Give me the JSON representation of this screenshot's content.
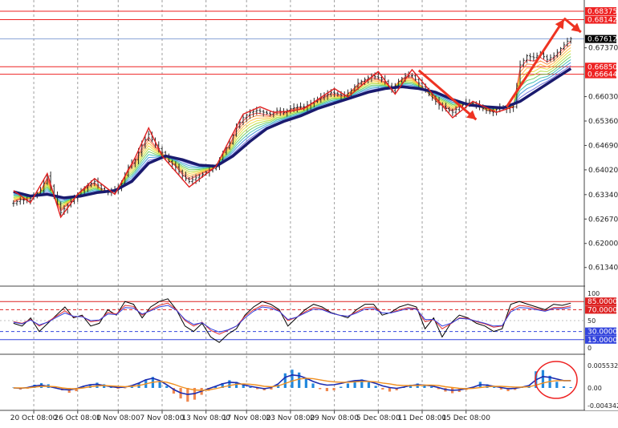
{
  "chart_data": [
    {
      "type": "line",
      "panel": "price",
      "ylim": [
        0.6085,
        0.6855
      ],
      "y_ticks": [
        "0.61340",
        "0.62000",
        "0.62670",
        "0.63340",
        "0.64020",
        "0.64690",
        "0.65360",
        "0.66030",
        "0.67370"
      ],
      "y_tick_values": [
        0.6134,
        0.62,
        0.6267,
        0.6334,
        0.6402,
        0.6469,
        0.6536,
        0.6603,
        0.6737
      ],
      "last_price": {
        "label": "0.67612",
        "value": 0.67612
      },
      "horizontal_levels": [
        {
          "label": "0.68375",
          "value": 0.68375
        },
        {
          "label": "0.68142",
          "value": 0.68142
        },
        {
          "label": "0.66850",
          "value": 0.6685
        },
        {
          "label": "0.66644",
          "value": 0.66644
        }
      ],
      "zigzag": [
        [
          0,
          0.6345
        ],
        [
          5,
          0.6312
        ],
        [
          10,
          0.6392
        ],
        [
          14,
          0.6272
        ],
        [
          19,
          0.6335
        ],
        [
          24,
          0.6378
        ],
        [
          30,
          0.6335
        ],
        [
          36,
          0.6435
        ],
        [
          40,
          0.6517
        ],
        [
          44,
          0.644
        ],
        [
          52,
          0.6355
        ],
        [
          60,
          0.6412
        ],
        [
          64,
          0.6485
        ],
        [
          68,
          0.6555
        ],
        [
          73,
          0.6575
        ],
        [
          77,
          0.656
        ],
        [
          82,
          0.6563
        ],
        [
          86,
          0.657
        ],
        [
          95,
          0.6625
        ],
        [
          99,
          0.6602
        ],
        [
          108,
          0.6672
        ],
        [
          113,
          0.661
        ],
        [
          118,
          0.6677
        ],
        [
          130,
          0.6545
        ],
        [
          136,
          0.659
        ],
        [
          143,
          0.656
        ],
        [
          148,
          0.6575
        ]
      ],
      "close_series": [
        [
          0,
          0.631
        ],
        [
          2,
          0.632
        ],
        [
          4,
          0.6318
        ],
        [
          6,
          0.633
        ],
        [
          8,
          0.6345
        ],
        [
          10,
          0.6385
        ],
        [
          12,
          0.633
        ],
        [
          14,
          0.6285
        ],
        [
          16,
          0.6305
        ],
        [
          18,
          0.6325
        ],
        [
          20,
          0.6345
        ],
        [
          22,
          0.636
        ],
        [
          24,
          0.637
        ],
        [
          26,
          0.635
        ],
        [
          28,
          0.634
        ],
        [
          30,
          0.6345
        ],
        [
          32,
          0.6365
        ],
        [
          34,
          0.641
        ],
        [
          36,
          0.643
        ],
        [
          38,
          0.647
        ],
        [
          40,
          0.65
        ],
        [
          42,
          0.647
        ],
        [
          44,
          0.645
        ],
        [
          46,
          0.6425
        ],
        [
          48,
          0.641
        ],
        [
          50,
          0.6385
        ],
        [
          52,
          0.637
        ],
        [
          54,
          0.638
        ],
        [
          56,
          0.639
        ],
        [
          58,
          0.64
        ],
        [
          60,
          0.641
        ],
        [
          62,
          0.645
        ],
        [
          64,
          0.6475
        ],
        [
          66,
          0.652
        ],
        [
          68,
          0.6545
        ],
        [
          70,
          0.656
        ],
        [
          72,
          0.6565
        ],
        [
          74,
          0.656
        ],
        [
          76,
          0.6555
        ],
        [
          78,
          0.6565
        ],
        [
          80,
          0.656
        ],
        [
          82,
          0.657
        ],
        [
          84,
          0.6575
        ],
        [
          86,
          0.6575
        ],
        [
          88,
          0.6585
        ],
        [
          90,
          0.6595
        ],
        [
          92,
          0.6605
        ],
        [
          94,
          0.6615
        ],
        [
          96,
          0.661
        ],
        [
          98,
          0.6605
        ],
        [
          100,
          0.662
        ],
        [
          102,
          0.664
        ],
        [
          104,
          0.665
        ],
        [
          106,
          0.666
        ],
        [
          108,
          0.6655
        ],
        [
          110,
          0.6645
        ],
        [
          112,
          0.662
        ],
        [
          114,
          0.6645
        ],
        [
          116,
          0.666
        ],
        [
          118,
          0.666
        ],
        [
          120,
          0.664
        ],
        [
          122,
          0.662
        ],
        [
          124,
          0.66
        ],
        [
          126,
          0.658
        ],
        [
          128,
          0.657
        ],
        [
          130,
          0.656
        ],
        [
          132,
          0.6575
        ],
        [
          134,
          0.6585
        ],
        [
          136,
          0.6585
        ],
        [
          138,
          0.6575
        ],
        [
          140,
          0.6565
        ],
        [
          142,
          0.656
        ],
        [
          144,
          0.6575
        ],
        [
          146,
          0.657
        ],
        [
          148,
          0.6575
        ],
        [
          150,
          0.669
        ],
        [
          152,
          0.6715
        ],
        [
          154,
          0.671
        ],
        [
          156,
          0.672
        ],
        [
          158,
          0.6705
        ],
        [
          160,
          0.6715
        ],
        [
          162,
          0.6735
        ],
        [
          164,
          0.6755
        ],
        [
          165,
          0.6762
        ]
      ],
      "ma_series": [
        [
          0,
          0.6342
        ],
        [
          5,
          0.633
        ],
        [
          10,
          0.6335
        ],
        [
          15,
          0.6325
        ],
        [
          20,
          0.633
        ],
        [
          25,
          0.634
        ],
        [
          30,
          0.6345
        ],
        [
          35,
          0.637
        ],
        [
          40,
          0.642
        ],
        [
          45,
          0.644
        ],
        [
          50,
          0.643
        ],
        [
          55,
          0.6415
        ],
        [
          60,
          0.6412
        ],
        [
          65,
          0.644
        ],
        [
          70,
          0.648
        ],
        [
          75,
          0.6515
        ],
        [
          80,
          0.6535
        ],
        [
          85,
          0.655
        ],
        [
          90,
          0.657
        ],
        [
          95,
          0.6585
        ],
        [
          100,
          0.66
        ],
        [
          105,
          0.6615
        ],
        [
          110,
          0.6625
        ],
        [
          115,
          0.663
        ],
        [
          120,
          0.6625
        ],
        [
          125,
          0.6615
        ],
        [
          130,
          0.6595
        ],
        [
          135,
          0.658
        ],
        [
          140,
          0.6575
        ],
        [
          145,
          0.6572
        ],
        [
          150,
          0.659
        ],
        [
          155,
          0.662
        ],
        [
          160,
          0.665
        ],
        [
          165,
          0.668
        ]
      ],
      "arrows": [
        {
          "from": [
            120,
            0.6675
          ],
          "to": [
            137,
            0.654
          ]
        },
        {
          "from": [
            146,
            0.6575
          ],
          "to": [
            163,
            0.6815
          ]
        },
        {
          "from": [
            163,
            0.6818
          ],
          "to": [
            168,
            0.678
          ]
        }
      ],
      "x_tick_labels": [
        "20 Oct 08:00",
        "26 Oct 08:00",
        "1 Nov 08:00",
        "7 Nov 08:00",
        "13 Nov 08:00",
        "17 Nov 08:00",
        "23 Nov 08:00",
        "29 Nov 08:00",
        "5 Dec 08:00",
        "11 Dec 08:00",
        "15 Dec 08:00"
      ],
      "x_tick_positions": [
        6,
        19,
        31,
        44,
        57,
        69,
        82,
        95,
        108,
        121,
        134
      ],
      "x_range": [
        -4,
        169
      ]
    },
    {
      "type": "line",
      "panel": "oscillator",
      "ylim": [
        0,
        100
      ],
      "y_ticks": [
        "100",
        "50",
        "0"
      ],
      "levels": [
        {
          "label": "85.0000",
          "value": 85,
          "color": "#dd2222"
        },
        {
          "label": "70.0000",
          "value": 70,
          "color": "#dd2222"
        },
        {
          "label": "30.0000",
          "value": 30,
          "color": "#3344dd"
        },
        {
          "label": "15.0000",
          "value": 15,
          "color": "#3344dd"
        }
      ],
      "series": [
        {
          "values": [
            45,
            40,
            55,
            30,
            45,
            60,
            75,
            55,
            60,
            40,
            45,
            70,
            60,
            85,
            80,
            55,
            75,
            85,
            90,
            70,
            40,
            30,
            45,
            20,
            10,
            25,
            35,
            60,
            75,
            85,
            80,
            70,
            40,
            55,
            70,
            80,
            75,
            65,
            60,
            55,
            70,
            80,
            80,
            60,
            65,
            75,
            80,
            75,
            35,
            55,
            20,
            45,
            60,
            55,
            45,
            40,
            30,
            35,
            80,
            85,
            80,
            75,
            70,
            80,
            78,
            82
          ],
          "color": "#000000"
        },
        {
          "values": [
            48,
            45,
            52,
            40,
            48,
            58,
            68,
            57,
            58,
            48,
            50,
            65,
            62,
            78,
            76,
            60,
            70,
            78,
            82,
            70,
            50,
            40,
            47,
            32,
            25,
            32,
            40,
            58,
            70,
            78,
            76,
            68,
            50,
            56,
            66,
            74,
            72,
            64,
            60,
            58,
            66,
            74,
            75,
            64,
            64,
            70,
            74,
            72,
            48,
            52,
            35,
            44,
            55,
            54,
            48,
            44,
            38,
            40,
            70,
            78,
            76,
            72,
            68,
            74,
            74,
            77
          ],
          "color": "#e03030"
        },
        {
          "values": [
            47,
            44,
            51,
            42,
            47,
            56,
            64,
            58,
            57,
            50,
            51,
            62,
            61,
            74,
            73,
            62,
            68,
            75,
            78,
            69,
            52,
            43,
            46,
            35,
            29,
            33,
            40,
            55,
            67,
            75,
            73,
            67,
            52,
            56,
            64,
            71,
            70,
            64,
            60,
            58,
            64,
            71,
            72,
            64,
            64,
            68,
            72,
            71,
            52,
            52,
            40,
            45,
            54,
            53,
            49,
            45,
            40,
            41,
            66,
            74,
            73,
            70,
            67,
            72,
            72,
            74
          ],
          "color": "#3040e0"
        }
      ]
    },
    {
      "type": "bar",
      "panel": "macd",
      "y_ticks": [
        "0.0055325",
        "0.00",
        "-0.0043426"
      ],
      "y_tick_values": [
        0.0055325,
        0.0,
        -0.0043426
      ],
      "ylim": [
        -0.0043426,
        0.0055325
      ],
      "histogram": [
        0.0001,
        -0.0004,
        -0.0002,
        0.0008,
        0.0012,
        0.0009,
        0.0003,
        -0.0006,
        -0.0012,
        -0.0008,
        0.0004,
        0.0009,
        0.0013,
        0.0009,
        0.0003,
        -0.0002,
        -0.0001,
        0.0004,
        0.0012,
        0.0021,
        0.0027,
        0.0016,
        0.0005,
        -0.0014,
        -0.0026,
        -0.0034,
        -0.0029,
        -0.0017,
        -0.0007,
        0.0004,
        0.0012,
        0.0019,
        0.0015,
        0.0007,
        0.0002,
        -0.0003,
        -0.0006,
        -0.0004,
        0.0008,
        0.0036,
        0.0045,
        0.0038,
        0.0024,
        0.0011,
        -0.0003,
        -0.0008,
        -0.0006,
        0.0003,
        0.0011,
        0.0017,
        0.0021,
        0.0014,
        0.0005,
        -0.0004,
        -0.0009,
        -0.0006,
        0.0002,
        0.0008,
        0.0011,
        0.0007,
        0.0003,
        -0.0003,
        -0.0009,
        -0.0013,
        -0.001,
        -0.0005,
        0.0003,
        0.0015,
        0.0009,
        0.0002,
        -0.0004,
        -0.0008,
        -0.0005,
        0.0002,
        0.0006,
        0.0041,
        0.0044,
        0.003,
        0.0015,
        0.0004,
        0.0002
      ],
      "macd_line": [
        0.0,
        -0.0001,
        0.0001,
        0.0005,
        0.0007,
        0.0004,
        0.0,
        -0.0004,
        -0.0005,
        -0.0002,
        0.0004,
        0.0008,
        0.0009,
        0.0006,
        0.0003,
        0.0001,
        0.0002,
        0.0006,
        0.0012,
        0.002,
        0.0024,
        0.0018,
        0.0008,
        -0.0004,
        -0.0012,
        -0.0016,
        -0.0014,
        -0.0008,
        -0.0002,
        0.0004,
        0.001,
        0.0014,
        0.0013,
        0.0008,
        0.0004,
        0.0001,
        -0.0002,
        0.0001,
        0.001,
        0.0026,
        0.0032,
        0.003,
        0.0024,
        0.0016,
        0.001,
        0.0007,
        0.0008,
        0.0011,
        0.0015,
        0.0018,
        0.0019,
        0.0016,
        0.0011,
        0.0005,
        0.0001,
        -0.0001,
        0.0002,
        0.0006,
        0.0008,
        0.0007,
        0.0005,
        0.0001,
        -0.0004,
        -0.0006,
        -0.0005,
        -0.0002,
        0.0002,
        0.0008,
        0.0007,
        0.0004,
        0.0001,
        -0.0002,
        -0.0001,
        0.0002,
        0.0006,
        0.002,
        0.0028,
        0.0026,
        0.0022,
        0.0018,
        0.0018
      ],
      "signal_line": [
        0.0,
        0.0,
        0.0,
        0.0002,
        0.0004,
        0.0004,
        0.0003,
        0.0,
        -0.0002,
        -0.0002,
        0.0,
        0.0003,
        0.0005,
        0.0006,
        0.0005,
        0.0004,
        0.0003,
        0.0004,
        0.0006,
        0.001,
        0.0014,
        0.0016,
        0.0014,
        0.0009,
        0.0003,
        -0.0002,
        -0.0005,
        -0.0006,
        -0.0005,
        -0.0002,
        0.0002,
        0.0006,
        0.0009,
        0.001,
        0.0009,
        0.0007,
        0.0004,
        0.0003,
        0.0005,
        0.0011,
        0.0017,
        0.0022,
        0.0024,
        0.0023,
        0.002,
        0.0017,
        0.0015,
        0.0014,
        0.0014,
        0.0015,
        0.0016,
        0.0016,
        0.0015,
        0.0012,
        0.001,
        0.0007,
        0.0006,
        0.0006,
        0.0006,
        0.0007,
        0.0007,
        0.0006,
        0.0003,
        0.0001,
        -0.0001,
        -0.0002,
        -0.0001,
        0.0001,
        0.0003,
        0.0004,
        0.0004,
        0.0003,
        0.0002,
        0.0002,
        0.0003,
        0.0007,
        0.0012,
        0.0016,
        0.0018,
        0.0018,
        0.0018
      ]
    }
  ],
  "colors": {
    "zigzag": "#e02020",
    "ma_thick": "#1a1a6e",
    "candles": "#2a2a2a",
    "arrow": "#ee3322",
    "level_line": "#ee2222",
    "last_price_bg": "#000000",
    "hist_pos": "#2288dd",
    "hist_neg": "#f08850",
    "macd_line": "#1a2ab0",
    "signal_line": "#f09020",
    "grid": "#888888"
  },
  "ribbon_colors": [
    "#ff2a2a",
    "#ff7a2a",
    "#ffb02a",
    "#e8d82a",
    "#a8d82a",
    "#5ac84a",
    "#2ab8a8",
    "#2a88d8",
    "#5a5ad8"
  ]
}
